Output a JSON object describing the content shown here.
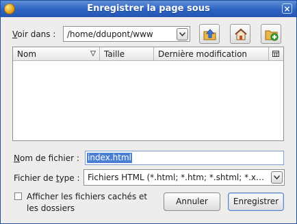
{
  "window": {
    "title": "Enregistrer la page sous",
    "close_glyph": "×"
  },
  "location": {
    "label_accel": "V",
    "label_rest": "oir dans :",
    "path": "/home/ddupont/www"
  },
  "toolbar": {
    "up_icon": "folder-up-icon",
    "home_icon": "home-icon",
    "new_folder_icon": "new-folder-icon"
  },
  "file_list": {
    "columns": [
      {
        "label": "Nom"
      },
      {
        "label": "Taille"
      },
      {
        "label": "Dernière modification"
      }
    ],
    "rows": []
  },
  "filename": {
    "label_accel": "N",
    "label_rest": "om de fichier :",
    "value": "index.html"
  },
  "filetype": {
    "label_pre": "Fichier de ",
    "label_accel": "t",
    "label_post": "ype :",
    "value": "Fichiers HTML (*.html; *.htm; *.shtml; *.xhtml)"
  },
  "hidden_files": {
    "checked": false,
    "label_line1": "Afficher les fichiers cachés et",
    "label_line2": "les dossiers"
  },
  "buttons": {
    "cancel": "Annuler",
    "save": "Enregistrer"
  },
  "colors": {
    "titlebar": "#2d63c2",
    "selection": "#4a7fd4",
    "dialog_bg": "#eeedeb"
  }
}
